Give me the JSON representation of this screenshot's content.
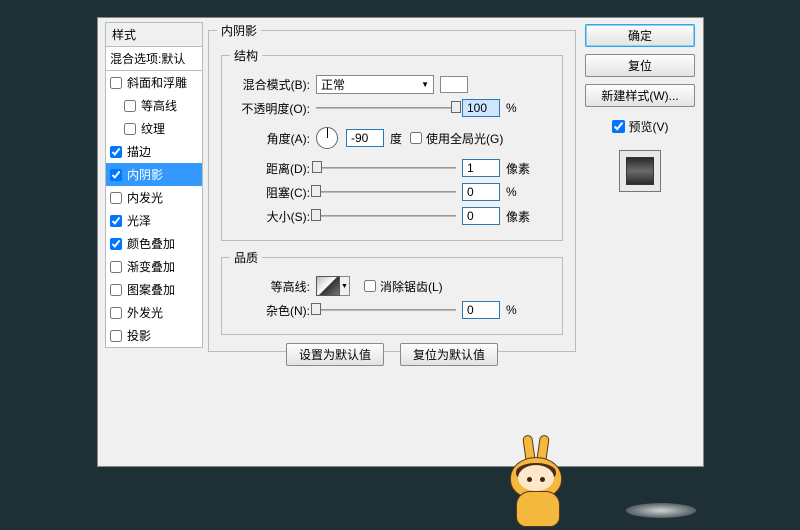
{
  "sidebar": {
    "header": "样式",
    "blending": "混合选项:默认",
    "items": [
      {
        "label": "斜面和浮雕",
        "checked": false,
        "indent": false
      },
      {
        "label": "等高线",
        "checked": false,
        "indent": true
      },
      {
        "label": "纹理",
        "checked": false,
        "indent": true
      },
      {
        "label": "描边",
        "checked": true,
        "indent": false
      },
      {
        "label": "内阴影",
        "checked": true,
        "indent": false,
        "selected": true
      },
      {
        "label": "内发光",
        "checked": false,
        "indent": false
      },
      {
        "label": "光泽",
        "checked": true,
        "indent": false
      },
      {
        "label": "颜色叠加",
        "checked": true,
        "indent": false
      },
      {
        "label": "渐变叠加",
        "checked": false,
        "indent": false
      },
      {
        "label": "图案叠加",
        "checked": false,
        "indent": false
      },
      {
        "label": "外发光",
        "checked": false,
        "indent": false
      },
      {
        "label": "投影",
        "checked": false,
        "indent": false
      }
    ]
  },
  "panel": {
    "title": "内阴影",
    "structure": {
      "legend": "结构",
      "blend_mode_label": "混合模式(B):",
      "blend_mode_value": "正常",
      "opacity_label": "不透明度(O):",
      "opacity_value": "100",
      "opacity_unit": "%",
      "angle_label": "角度(A):",
      "angle_value": "-90",
      "angle_unit": "度",
      "global_light_label": "使用全局光(G)",
      "distance_label": "距离(D):",
      "distance_value": "1",
      "distance_unit": "像素",
      "choke_label": "阻塞(C):",
      "choke_value": "0",
      "choke_unit": "%",
      "size_label": "大小(S):",
      "size_value": "0",
      "size_unit": "像素"
    },
    "quality": {
      "legend": "品质",
      "contour_label": "等高线:",
      "antialias_label": "消除锯齿(L)",
      "noise_label": "杂色(N):",
      "noise_value": "0",
      "noise_unit": "%"
    },
    "default_btn": "设置为默认值",
    "reset_btn": "复位为默认值"
  },
  "right": {
    "ok": "确定",
    "cancel": "复位",
    "new_style": "新建样式(W)...",
    "preview_label": "预览(V)"
  }
}
